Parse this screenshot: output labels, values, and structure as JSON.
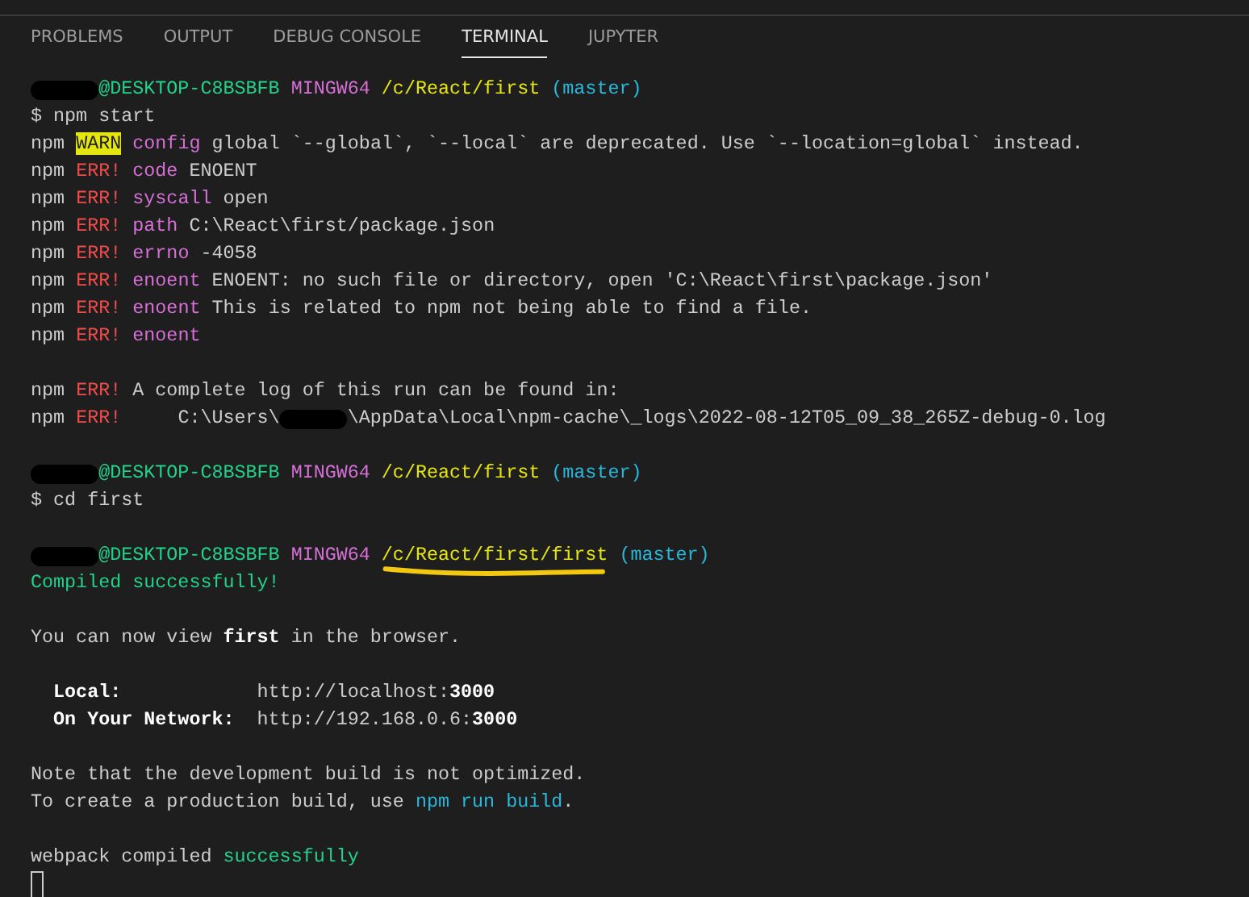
{
  "panel_tabs": [
    {
      "label": "PROBLEMS",
      "selected": false
    },
    {
      "label": "OUTPUT",
      "selected": false
    },
    {
      "label": "DEBUG CONSOLE",
      "selected": false
    },
    {
      "label": "TERMINAL",
      "selected": true
    },
    {
      "label": "JUPYTER",
      "selected": false
    }
  ],
  "terminal": {
    "lines": [
      {
        "kind": "text",
        "segments": [
          {
            "kind": "redacted"
          },
          {
            "kind": "green",
            "text": "@DESKTOP-C8BSBFB "
          },
          {
            "kind": "magenta",
            "text": "MINGW64 "
          },
          {
            "kind": "yellow",
            "text": "/c/React/first"
          },
          {
            "kind": "cyan",
            "text": " (master)"
          }
        ]
      },
      {
        "kind": "text",
        "segments": [
          {
            "kind": "plain",
            "text": "$ npm start"
          }
        ]
      },
      {
        "kind": "text",
        "segments": [
          {
            "kind": "plain",
            "text": "npm "
          },
          {
            "kind": "warn",
            "text": "WARN"
          },
          {
            "kind": "magenta",
            "text": " config"
          },
          {
            "kind": "plain",
            "text": " global `--global`, `--local` are deprecated. Use `--location=global` instead."
          }
        ]
      },
      {
        "kind": "text",
        "segments": [
          {
            "kind": "plain",
            "text": "npm "
          },
          {
            "kind": "red",
            "text": "ERR!"
          },
          {
            "kind": "magenta",
            "text": " code"
          },
          {
            "kind": "plain",
            "text": " ENOENT"
          }
        ]
      },
      {
        "kind": "text",
        "segments": [
          {
            "kind": "plain",
            "text": "npm "
          },
          {
            "kind": "red",
            "text": "ERR!"
          },
          {
            "kind": "magenta",
            "text": " syscall"
          },
          {
            "kind": "plain",
            "text": " open"
          }
        ]
      },
      {
        "kind": "text",
        "segments": [
          {
            "kind": "plain",
            "text": "npm "
          },
          {
            "kind": "red",
            "text": "ERR!"
          },
          {
            "kind": "magenta",
            "text": " path"
          },
          {
            "kind": "plain",
            "text": " C:\\React\\first/package.json"
          }
        ]
      },
      {
        "kind": "text",
        "segments": [
          {
            "kind": "plain",
            "text": "npm "
          },
          {
            "kind": "red",
            "text": "ERR!"
          },
          {
            "kind": "magenta",
            "text": " errno"
          },
          {
            "kind": "plain",
            "text": " -4058"
          }
        ]
      },
      {
        "kind": "text",
        "segments": [
          {
            "kind": "plain",
            "text": "npm "
          },
          {
            "kind": "red",
            "text": "ERR!"
          },
          {
            "kind": "magenta",
            "text": " enoent"
          },
          {
            "kind": "plain",
            "text": " ENOENT: no such file or directory, open 'C:\\React\\first\\package.json'"
          }
        ]
      },
      {
        "kind": "text",
        "segments": [
          {
            "kind": "plain",
            "text": "npm "
          },
          {
            "kind": "red",
            "text": "ERR!"
          },
          {
            "kind": "magenta",
            "text": " enoent"
          },
          {
            "kind": "plain",
            "text": " This is related to npm not being able to find a file."
          }
        ]
      },
      {
        "kind": "text",
        "segments": [
          {
            "kind": "plain",
            "text": "npm "
          },
          {
            "kind": "red",
            "text": "ERR!"
          },
          {
            "kind": "magenta",
            "text": " enoent"
          }
        ]
      },
      {
        "kind": "blank"
      },
      {
        "kind": "text",
        "segments": [
          {
            "kind": "plain",
            "text": "npm "
          },
          {
            "kind": "red",
            "text": "ERR!"
          },
          {
            "kind": "plain",
            "text": " A complete log of this run can be found in:"
          }
        ]
      },
      {
        "kind": "text",
        "segments": [
          {
            "kind": "plain",
            "text": "npm "
          },
          {
            "kind": "red",
            "text": "ERR!"
          },
          {
            "kind": "plain",
            "text": "     C:\\Users\\"
          },
          {
            "kind": "redacted"
          },
          {
            "kind": "plain",
            "text": "\\AppData\\Local\\npm-cache\\_logs\\2022-08-12T05_09_38_265Z-debug-0.log"
          }
        ]
      },
      {
        "kind": "blank"
      },
      {
        "kind": "text",
        "segments": [
          {
            "kind": "redacted"
          },
          {
            "kind": "green",
            "text": "@DESKTOP-C8BSBFB "
          },
          {
            "kind": "magenta",
            "text": "MINGW64 "
          },
          {
            "kind": "yellow",
            "text": "/c/React/first"
          },
          {
            "kind": "cyan",
            "text": " (master)"
          }
        ]
      },
      {
        "kind": "text",
        "segments": [
          {
            "kind": "plain",
            "text": "$ cd first"
          }
        ]
      },
      {
        "kind": "blank"
      },
      {
        "kind": "text",
        "segments": [
          {
            "kind": "redacted"
          },
          {
            "kind": "green",
            "text": "@DESKTOP-C8BSBFB "
          },
          {
            "kind": "magenta",
            "text": "MINGW64 "
          },
          {
            "kind": "underlined",
            "text": "/c/React/first/first"
          },
          {
            "kind": "cyan",
            "text": " (master)"
          }
        ]
      },
      {
        "kind": "text",
        "segments": [
          {
            "kind": "green",
            "text": "Compiled successfully!"
          }
        ]
      },
      {
        "kind": "blank"
      },
      {
        "kind": "text",
        "segments": [
          {
            "kind": "plain",
            "text": "You can now view "
          },
          {
            "kind": "bold",
            "text": "first"
          },
          {
            "kind": "plain",
            "text": " in the browser."
          }
        ]
      },
      {
        "kind": "blank"
      },
      {
        "kind": "text",
        "segments": [
          {
            "kind": "bold",
            "text": "  Local:"
          },
          {
            "kind": "plain",
            "text": "            http://localhost:"
          },
          {
            "kind": "bold",
            "text": "3000"
          }
        ]
      },
      {
        "kind": "text",
        "segments": [
          {
            "kind": "bold",
            "text": "  On Your Network:"
          },
          {
            "kind": "plain",
            "text": "  http://192.168.0.6:"
          },
          {
            "kind": "bold",
            "text": "3000"
          }
        ]
      },
      {
        "kind": "blank"
      },
      {
        "kind": "text",
        "segments": [
          {
            "kind": "plain",
            "text": "Note that the development build is not optimized."
          }
        ]
      },
      {
        "kind": "text",
        "segments": [
          {
            "kind": "plain",
            "text": "To create a production build, use "
          },
          {
            "kind": "cyan",
            "text": "npm run build"
          },
          {
            "kind": "plain",
            "text": "."
          }
        ]
      },
      {
        "kind": "blank"
      },
      {
        "kind": "text",
        "segments": [
          {
            "kind": "plain",
            "text": "webpack compiled "
          },
          {
            "kind": "green",
            "text": "successfully"
          }
        ]
      },
      {
        "kind": "cursor"
      }
    ]
  }
}
